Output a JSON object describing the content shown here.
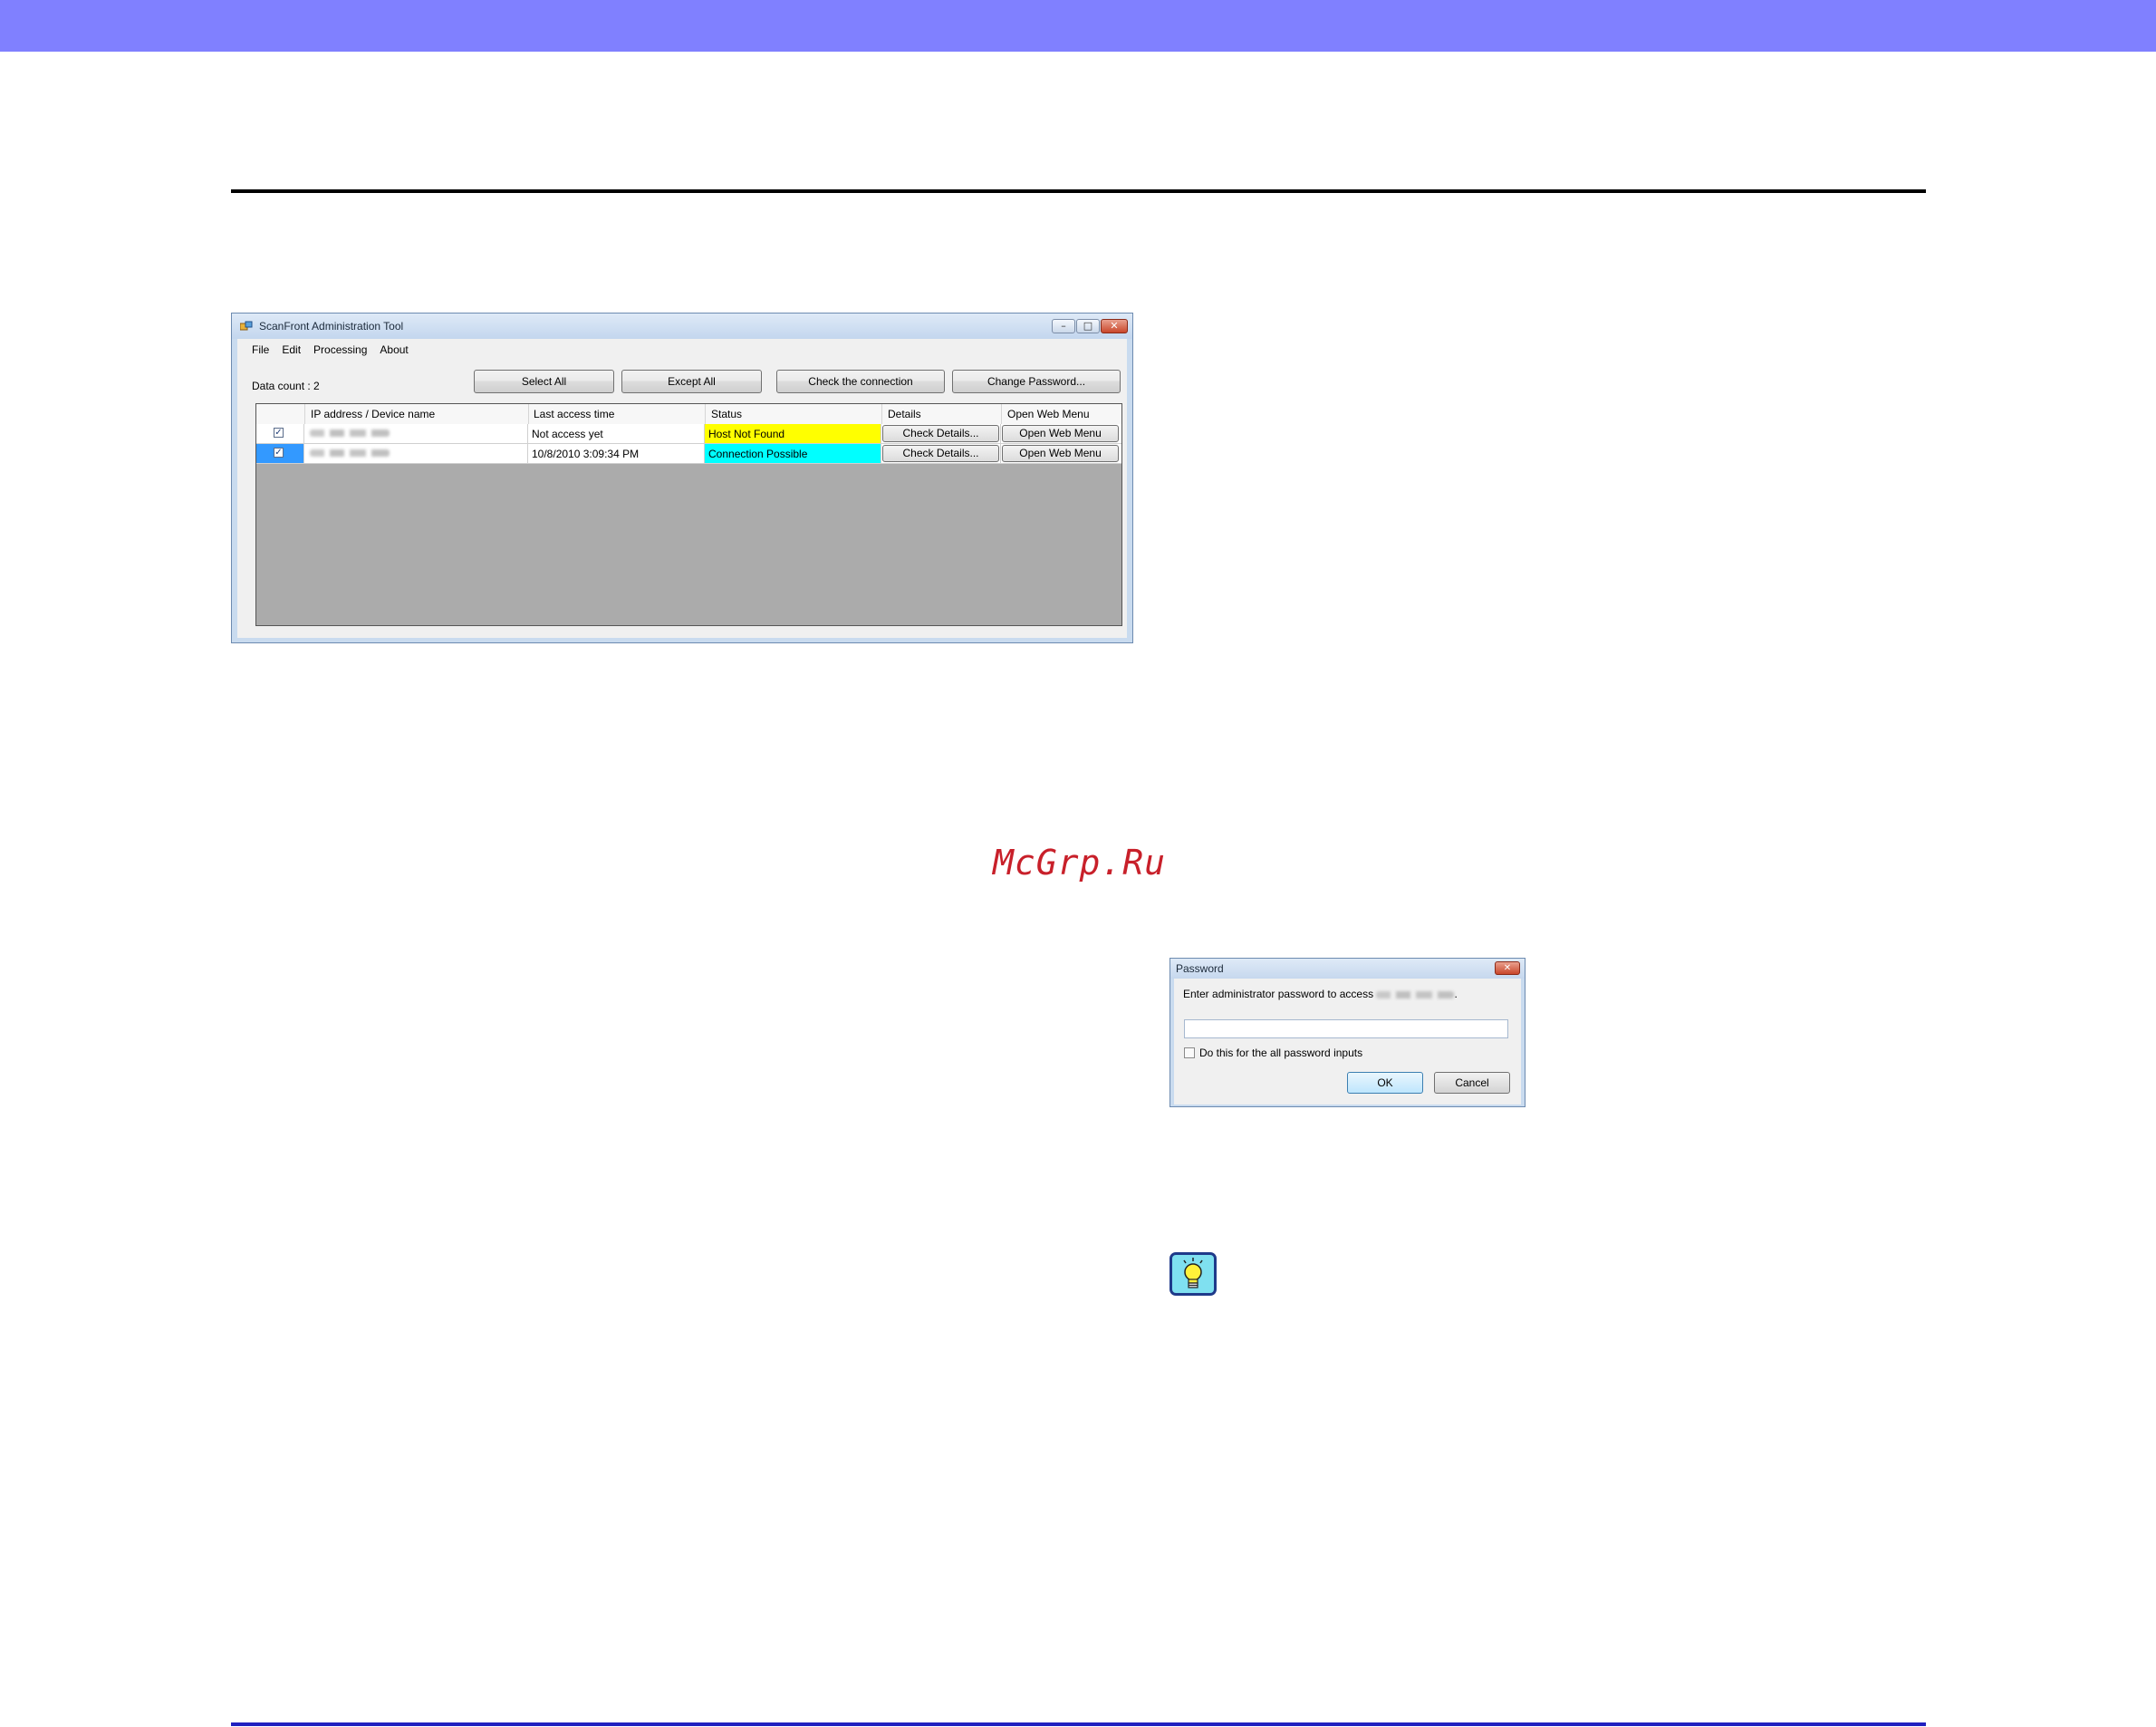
{
  "window": {
    "title": "ScanFront Administration Tool",
    "minimize_glyph": "–",
    "maximize_glyph": "□",
    "close_glyph": "✕"
  },
  "menu": [
    "File",
    "Edit",
    "Processing",
    "About"
  ],
  "data_count": "Data count : 2",
  "toolbar": {
    "select_all": "Select All",
    "except_all": "Except All",
    "check_connection": "Check the connection",
    "change_password": "Change Password..."
  },
  "grid": {
    "columns": [
      "IP address / Device name",
      "Last access time",
      "Status",
      "Details",
      "Open Web Menu"
    ],
    "rows": [
      {
        "checked": "✓",
        "last_access": "Not access yet",
        "status": "Host Not Found",
        "status_color": "#ffff00",
        "details": "Check Details...",
        "web": "Open Web Menu"
      },
      {
        "checked": "✓",
        "last_access": "10/8/2010 3:09:34 PM",
        "status": "Connection Possible",
        "status_color": "#00ffff",
        "details": "Check Details...",
        "web": "Open Web Menu"
      }
    ]
  },
  "watermark": "McGrp.Ru",
  "password_dialog": {
    "title": "Password",
    "prompt_prefix": "Enter administrator password to access",
    "prompt_suffix": ".",
    "checkbox_label": "Do this for the all password inputs",
    "ok": "OK",
    "cancel": "Cancel",
    "close_glyph": "✕"
  },
  "colors": {
    "top_band": "#8080ff",
    "bottom_rule": "#2020c0",
    "watermark": "#c8202a",
    "hint_icon_bg": "#7fe0f0"
  },
  "icons": [
    "lightbulb-hint-icon",
    "app-icon"
  ]
}
